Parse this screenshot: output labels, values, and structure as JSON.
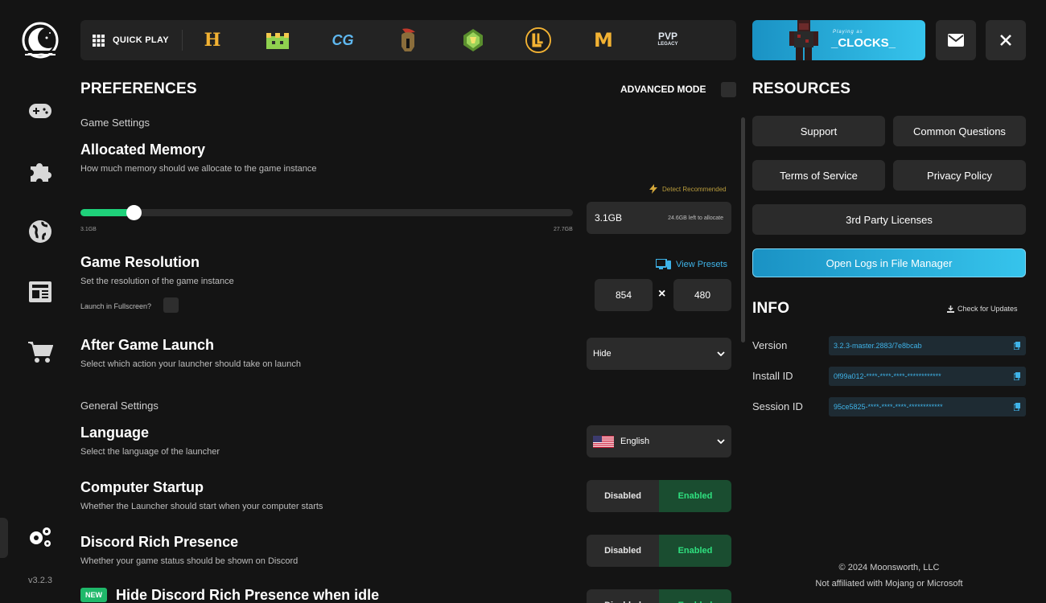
{
  "app": {
    "version": "v3.2.3"
  },
  "quick_play": {
    "label": "QUICK PLAY",
    "servers": [
      {
        "icon": "hypixel-icon",
        "glyph": "H"
      },
      {
        "icon": "mineplex-icon",
        "glyph": ""
      },
      {
        "icon": "cubecraft-icon",
        "glyph": "CG"
      },
      {
        "icon": "spartan-helmet-icon",
        "glyph": ""
      },
      {
        "icon": "wynncraft-icon",
        "glyph": ""
      },
      {
        "icon": "lemoncloud-icon",
        "glyph": "L"
      },
      {
        "icon": "minemen-icon",
        "glyph": "M"
      },
      {
        "icon": "pvp-legacy-icon",
        "glyph": "PVP"
      }
    ]
  },
  "profile": {
    "playing_as": "Playing as",
    "username": "_CLOCKS_"
  },
  "preferences": {
    "title": "PREFERENCES",
    "advanced_mode": "ADVANCED MODE",
    "game_settings": "Game Settings",
    "memory": {
      "title": "Allocated Memory",
      "desc": "How much memory should we allocate to the game instance",
      "detect": "Detect Recommended",
      "value": "3.1GB",
      "left": "24.6GB left to allocate",
      "min": "3.1GB",
      "max": "27.7GB",
      "fill_fraction": 0.108
    },
    "resolution": {
      "title": "Game Resolution",
      "desc": "Set the resolution of the game instance",
      "presets": "View Presets",
      "fullscreen": "Launch in Fullscreen?",
      "width": "854",
      "x": "×",
      "height": "480"
    },
    "after_launch": {
      "title": "After Game Launch",
      "desc": "Select which action your launcher should take on launch",
      "value": "Hide"
    },
    "general_settings": "General Settings",
    "language": {
      "title": "Language",
      "desc": "Select the language of the launcher",
      "value": "English"
    },
    "startup": {
      "title": "Computer Startup",
      "desc": "Whether the Launcher should start when your computer starts",
      "off": "Disabled",
      "on": "Enabled"
    },
    "discord": {
      "title": "Discord Rich Presence",
      "desc": "Whether your game status should be shown on Discord",
      "off": "Disabled",
      "on": "Enabled"
    },
    "discord_idle": {
      "badge": "NEW",
      "title": "Hide Discord Rich Presence when idle",
      "off": "Disabled",
      "on": "Enabled"
    }
  },
  "resources": {
    "title": "RESOURCES",
    "support": "Support",
    "questions": "Common Questions",
    "terms": "Terms of Service",
    "privacy": "Privacy Policy",
    "licenses": "3rd Party Licenses",
    "logs": "Open Logs in File Manager"
  },
  "info": {
    "title": "INFO",
    "check_updates": "Check for Updates",
    "version_label": "Version",
    "version_value": "3.2.3-master.2883/7e8bcab",
    "install_label": "Install ID",
    "install_value": "0f99a012-****-****-****-************",
    "session_label": "Session ID",
    "session_value": "95ce5825-****-****-****-************"
  },
  "footer": {
    "copyright": "© 2024 Moonsworth, LLC",
    "disclaimer": "Not affiliated with Mojang or Microsoft"
  }
}
